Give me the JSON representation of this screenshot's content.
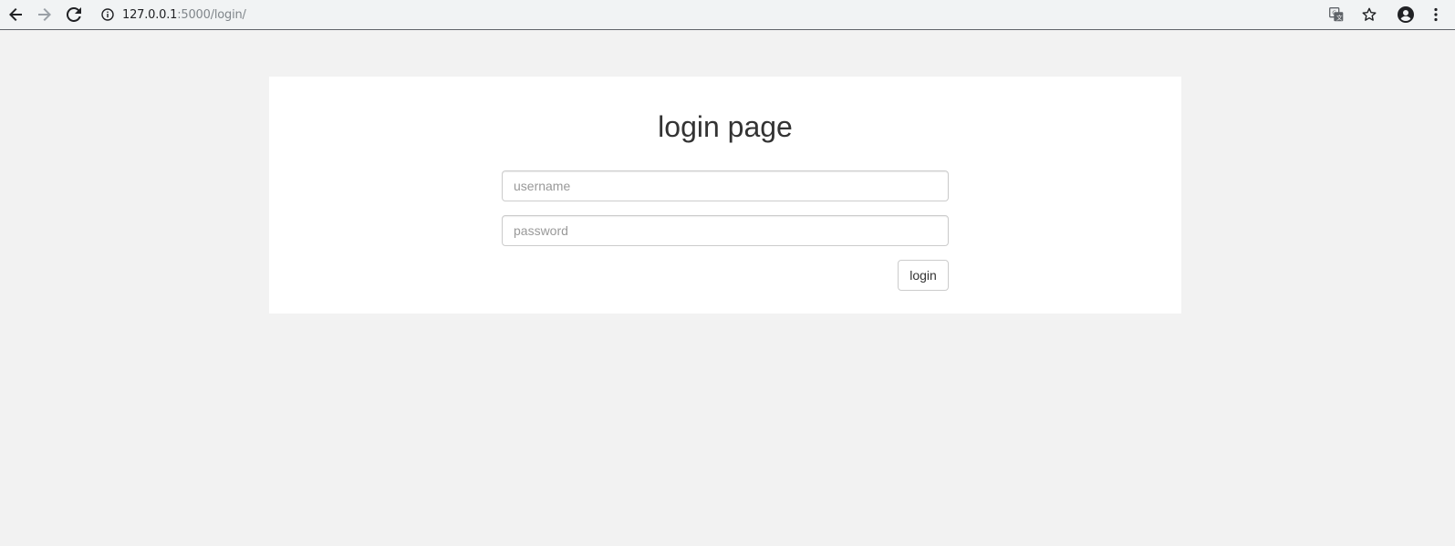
{
  "browser": {
    "url_host": "127.0.0.1",
    "url_rest": ":5000/login/",
    "icons": {
      "back": "back-arrow-icon",
      "forward": "forward-arrow-icon",
      "reload": "reload-icon",
      "info": "info-icon",
      "translate": "translate-icon",
      "bookmark": "star-icon",
      "profile": "account-icon",
      "menu": "kebab-menu-icon"
    }
  },
  "login": {
    "title": "login page",
    "username_placeholder": "username",
    "password_placeholder": "password",
    "submit_label": "login"
  },
  "colors": {
    "page_background": "#f2f2f2",
    "card_background": "#ffffff",
    "border": "#cccccc",
    "text": "#333333"
  }
}
